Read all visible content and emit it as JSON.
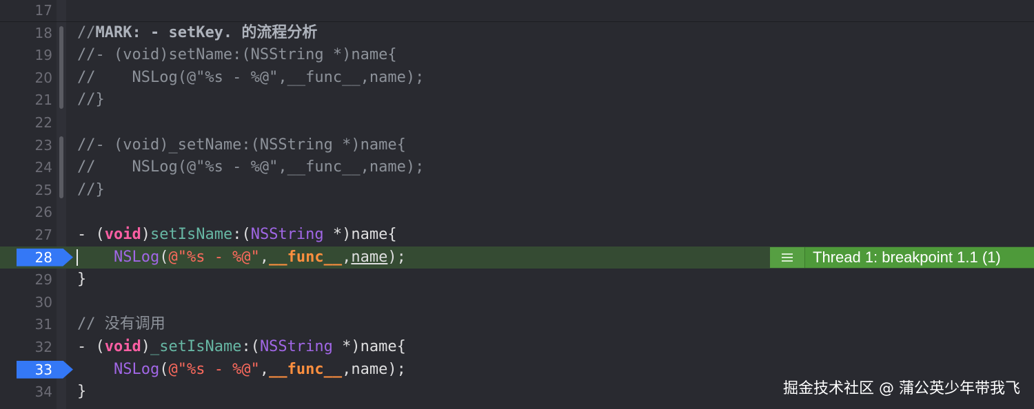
{
  "watermark": "掘金技术社区 @ 蒲公英少年带我飞",
  "breakpoint_label": "Thread 1: breakpoint 1.1 (1)",
  "colors": {
    "background": "#292a30",
    "highlight_line": "#354b33",
    "breakpoint": "#3478f6",
    "annotation": "#4e9a3a",
    "comment": "#8d929a",
    "keyword": "#fc5fa3",
    "method": "#67b7a4",
    "type": "#a167e6",
    "string": "#fc6a5d",
    "macro": "#fd8f3f"
  },
  "lines": [
    {
      "number": "17",
      "parts": []
    },
    {
      "number": "18",
      "parts": [
        {
          "t": "//",
          "c": "cmt"
        },
        {
          "t": "MARK: - setKey. 的流程分析",
          "c": "mark"
        }
      ]
    },
    {
      "number": "19",
      "parts": [
        {
          "t": "//- (void)setName:(NSString *)name{",
          "c": "cmt"
        }
      ]
    },
    {
      "number": "20",
      "parts": [
        {
          "t": "//    NSLog(@\"%s - %@\",__func__,name);",
          "c": "cmt"
        }
      ]
    },
    {
      "number": "21",
      "parts": [
        {
          "t": "//}",
          "c": "cmt"
        }
      ]
    },
    {
      "number": "22",
      "parts": []
    },
    {
      "number": "23",
      "parts": [
        {
          "t": "//- (void)_setName:(NSString *)name{",
          "c": "cmt"
        }
      ]
    },
    {
      "number": "24",
      "parts": [
        {
          "t": "//    NSLog(@\"%s - %@\",__func__,name);",
          "c": "cmt"
        }
      ]
    },
    {
      "number": "25",
      "parts": [
        {
          "t": "//}",
          "c": "cmt"
        }
      ]
    },
    {
      "number": "26",
      "parts": []
    },
    {
      "number": "27",
      "parts": [
        {
          "t": "- (",
          "c": "plain"
        },
        {
          "t": "void",
          "c": "kw"
        },
        {
          "t": ")",
          "c": "plain"
        },
        {
          "t": "setIsName",
          "c": "method"
        },
        {
          "t": ":(",
          "c": "plain"
        },
        {
          "t": "NSString",
          "c": "type"
        },
        {
          "t": " *)name{",
          "c": "plain"
        }
      ]
    },
    {
      "number": "28",
      "parts": [
        {
          "t": "    ",
          "c": "plain"
        },
        {
          "t": "NSLog",
          "c": "func"
        },
        {
          "t": "(",
          "c": "plain"
        },
        {
          "t": "@\"%s - %@\"",
          "c": "str"
        },
        {
          "t": ",",
          "c": "plain"
        },
        {
          "t": "__func__",
          "c": "macro"
        },
        {
          "t": ",",
          "c": "plain"
        },
        {
          "t": "name",
          "c": "underline"
        },
        {
          "t": ");",
          "c": "plain"
        }
      ]
    },
    {
      "number": "29",
      "parts": [
        {
          "t": "}",
          "c": "plain"
        }
      ]
    },
    {
      "number": "30",
      "parts": []
    },
    {
      "number": "31",
      "parts": [
        {
          "t": "// 没有调用",
          "c": "cmt"
        }
      ]
    },
    {
      "number": "32",
      "parts": [
        {
          "t": "- (",
          "c": "plain"
        },
        {
          "t": "void",
          "c": "kw"
        },
        {
          "t": ")",
          "c": "plain"
        },
        {
          "t": "_setIsName",
          "c": "method"
        },
        {
          "t": ":(",
          "c": "plain"
        },
        {
          "t": "NSString",
          "c": "type"
        },
        {
          "t": " *)name{",
          "c": "plain"
        }
      ]
    },
    {
      "number": "33",
      "parts": [
        {
          "t": "    ",
          "c": "plain"
        },
        {
          "t": "NSLog",
          "c": "func"
        },
        {
          "t": "(",
          "c": "plain"
        },
        {
          "t": "@\"%s - %@\"",
          "c": "str"
        },
        {
          "t": ",",
          "c": "plain"
        },
        {
          "t": "__func__",
          "c": "macro"
        },
        {
          "t": ",name);",
          "c": "plain"
        }
      ]
    },
    {
      "number": "34",
      "parts": [
        {
          "t": "}",
          "c": "plain"
        }
      ]
    }
  ]
}
